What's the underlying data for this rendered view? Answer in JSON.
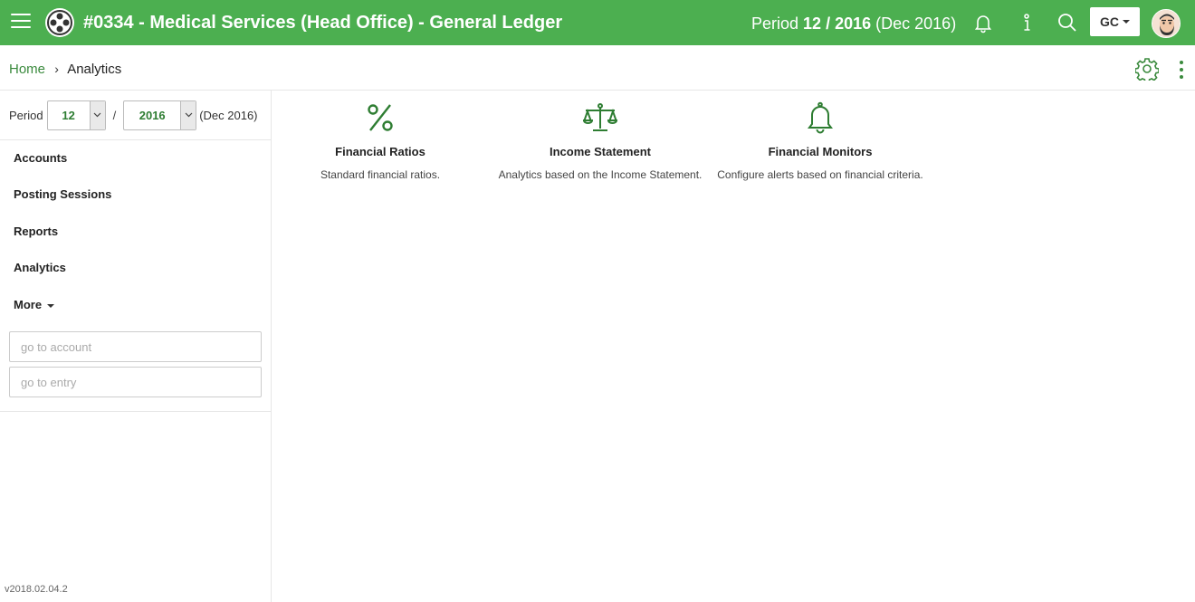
{
  "header": {
    "title": "#0334 - Medical Services (Head Office) - General Ledger",
    "period_label": "Period",
    "period_value": "12 / 2016",
    "period_text": "(Dec 2016)",
    "user_initials": "GC",
    "accent_color": "#4caf50",
    "icons": [
      "menu-icon",
      "logo-icon",
      "bell-icon",
      "info-icon",
      "search-icon",
      "avatar"
    ]
  },
  "breadcrumb": {
    "home": "Home",
    "separator": "›",
    "current": "Analytics"
  },
  "sidebar": {
    "period_label": "Period",
    "month": "12",
    "slash": "/",
    "year": "2016",
    "period_text": "(Dec 2016)",
    "items": [
      {
        "label": "Accounts"
      },
      {
        "label": "Posting Sessions"
      },
      {
        "label": "Reports"
      },
      {
        "label": "Analytics"
      },
      {
        "label": "More"
      }
    ],
    "account_placeholder": "go to account",
    "entry_placeholder": "go to entry",
    "version": "v2018.02.04.2"
  },
  "cards": [
    {
      "title": "Financial Ratios",
      "description": "Standard financial ratios.",
      "icon": "percent-icon"
    },
    {
      "title": "Income Statement",
      "description": "Analytics based on the Income Statement.",
      "icon": "scale-icon"
    },
    {
      "title": "Financial Monitors",
      "description": "Configure alerts based on financial criteria.",
      "icon": "bell-icon"
    }
  ]
}
